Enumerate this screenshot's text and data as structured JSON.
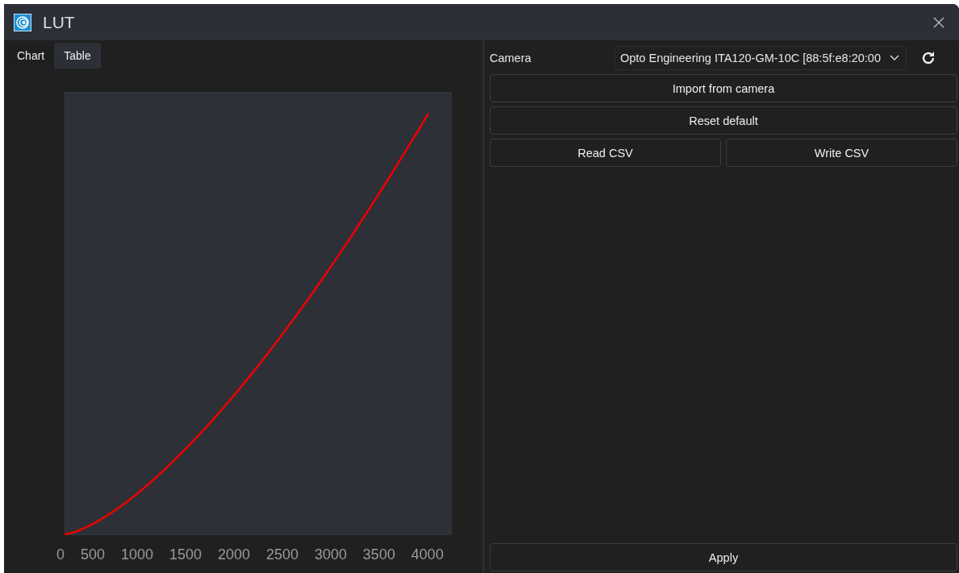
{
  "window": {
    "title": "LUT"
  },
  "tabs": [
    {
      "label": "Chart",
      "selected": true
    },
    {
      "label": "Table",
      "selected": false
    }
  ],
  "chart": {
    "x_tick_labels": [
      "0",
      "500",
      "1000",
      "1500",
      "2000",
      "2500",
      "3000",
      "3500",
      "4000"
    ]
  },
  "camera": {
    "label": "Camera",
    "value": "Opto Engineering ITA120-GM-10C [88:5f:e8:20:00"
  },
  "button_rows": [
    [
      "Import from camera"
    ],
    [
      "Reset default"
    ],
    [
      "Read CSV",
      "Write CSV"
    ]
  ],
  "apply_button": {
    "label": "Apply"
  }
}
